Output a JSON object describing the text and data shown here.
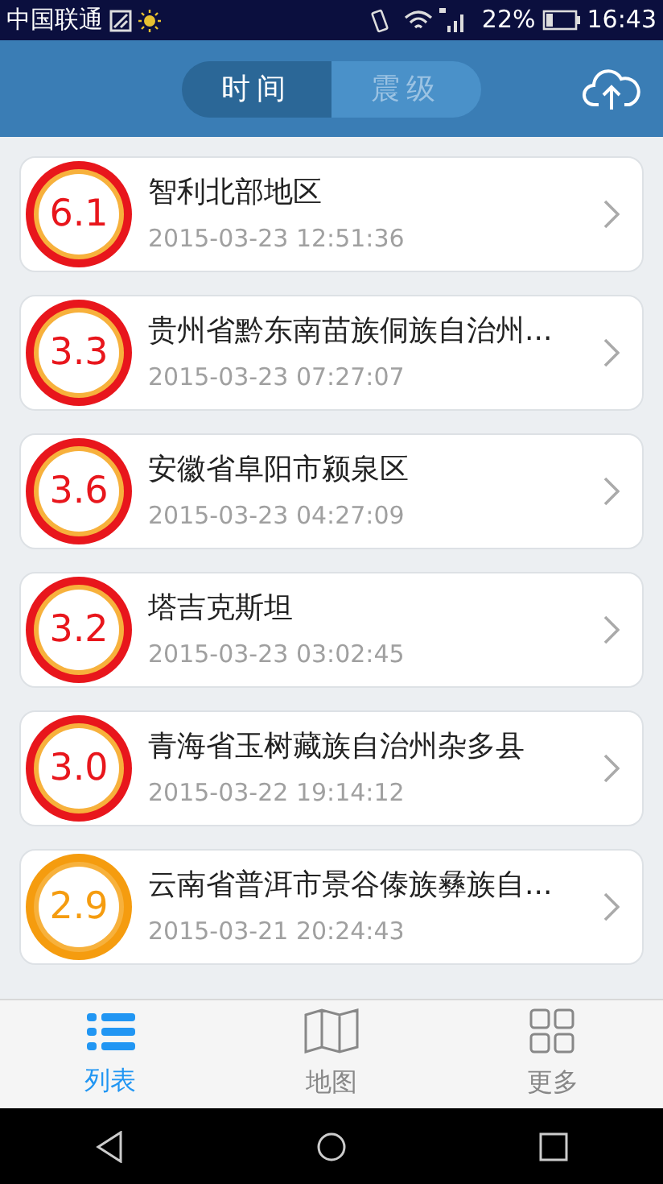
{
  "status_bar": {
    "carrier": "中国联通",
    "battery": "22%",
    "time": "16:43"
  },
  "header": {
    "segments": [
      {
        "label": "时间",
        "selected": true
      },
      {
        "label": "震级",
        "selected": false
      }
    ]
  },
  "quakes": [
    {
      "magnitude": "6.1",
      "place": "智利北部地区",
      "time": "2015-03-23 12:51:36",
      "color": "#e8161c"
    },
    {
      "magnitude": "3.3",
      "place": "贵州省黔东南苗族侗族自治州...",
      "time": "2015-03-23 07:27:07",
      "color": "#e8161c"
    },
    {
      "magnitude": "3.6",
      "place": "安徽省阜阳市颍泉区",
      "time": "2015-03-23 04:27:09",
      "color": "#e8161c"
    },
    {
      "magnitude": "3.2",
      "place": "塔吉克斯坦",
      "time": "2015-03-23 03:02:45",
      "color": "#e8161c"
    },
    {
      "magnitude": "3.0",
      "place": "青海省玉树藏族自治州杂多县",
      "time": "2015-03-22 19:14:12",
      "color": "#e8161c"
    },
    {
      "magnitude": "2.9",
      "place": "云南省普洱市景谷傣族彝族自...",
      "time": "2015-03-21 20:24:43",
      "color": "#f59c0f"
    }
  ],
  "tab_bar": [
    {
      "label": "列表",
      "kind": "list",
      "selected": true
    },
    {
      "label": "地图",
      "kind": "map",
      "selected": false
    },
    {
      "label": "更多",
      "kind": "grid",
      "selected": false
    }
  ]
}
